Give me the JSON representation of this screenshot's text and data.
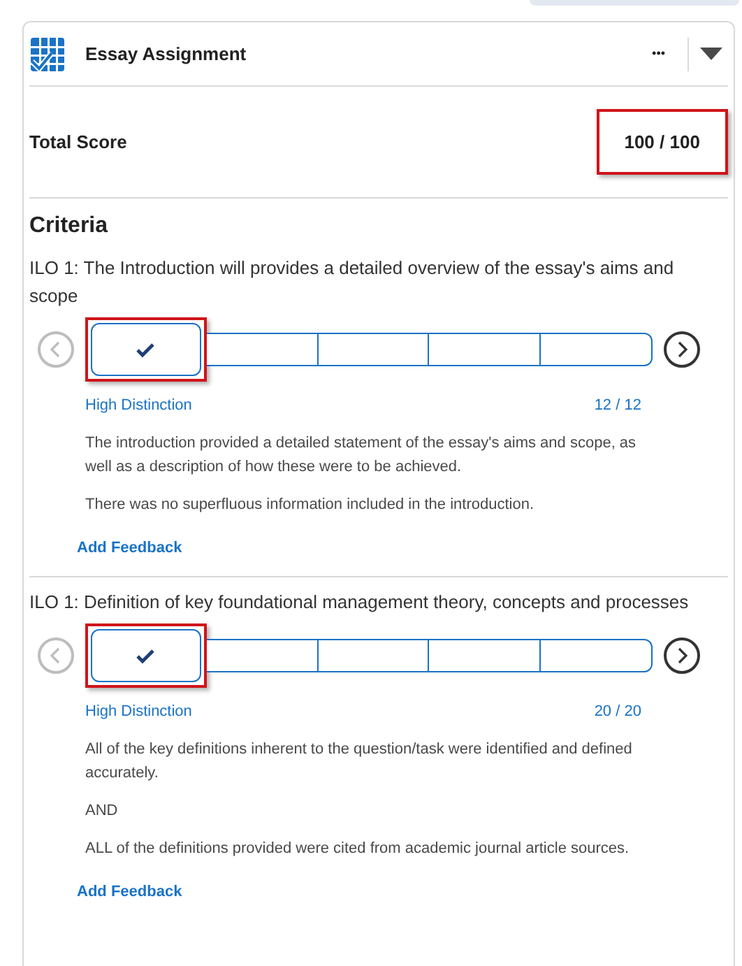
{
  "header": {
    "title": "Essay Assignment",
    "more": "•••"
  },
  "total_score": {
    "label": "Total Score",
    "score": "100",
    "separator": "/",
    "max": "100",
    "annotated": true
  },
  "criteria_heading": "Criteria",
  "criteria": [
    {
      "title": "ILO 1: The Introduction will provides a detailed overview of the essay's aims and scope",
      "levels": [
        {
          "selected": true,
          "annotated": true
        },
        {
          "selected": false,
          "annotated": false
        },
        {
          "selected": false,
          "annotated": false
        },
        {
          "selected": false,
          "annotated": false
        },
        {
          "selected": false,
          "annotated": false
        }
      ],
      "prev_disabled": true,
      "level_name": "High Distinction",
      "score": "12",
      "separator": "/",
      "max": "12",
      "description": [
        "The introduction provided a detailed statement of the essay's aims and scope, as well as a description of how these were to be achieved.",
        "There was no superfluous information included in the introduction."
      ],
      "feedback": "Add Feedback"
    },
    {
      "title": "ILO 1: Definition of key foundational management theory, concepts and processes",
      "levels": [
        {
          "selected": true,
          "annotated": true
        },
        {
          "selected": false,
          "annotated": false
        },
        {
          "selected": false,
          "annotated": false
        },
        {
          "selected": false,
          "annotated": false
        },
        {
          "selected": false,
          "annotated": false
        }
      ],
      "prev_disabled": true,
      "level_name": "High Distinction",
      "score": "20",
      "separator": "/",
      "max": "20",
      "description": [
        "All of the key definitions inherent to the question/task were identified and defined accurately.",
        "AND",
        "ALL of the definitions provided were cited from academic journal article sources."
      ],
      "feedback": "Add Feedback"
    }
  ]
}
